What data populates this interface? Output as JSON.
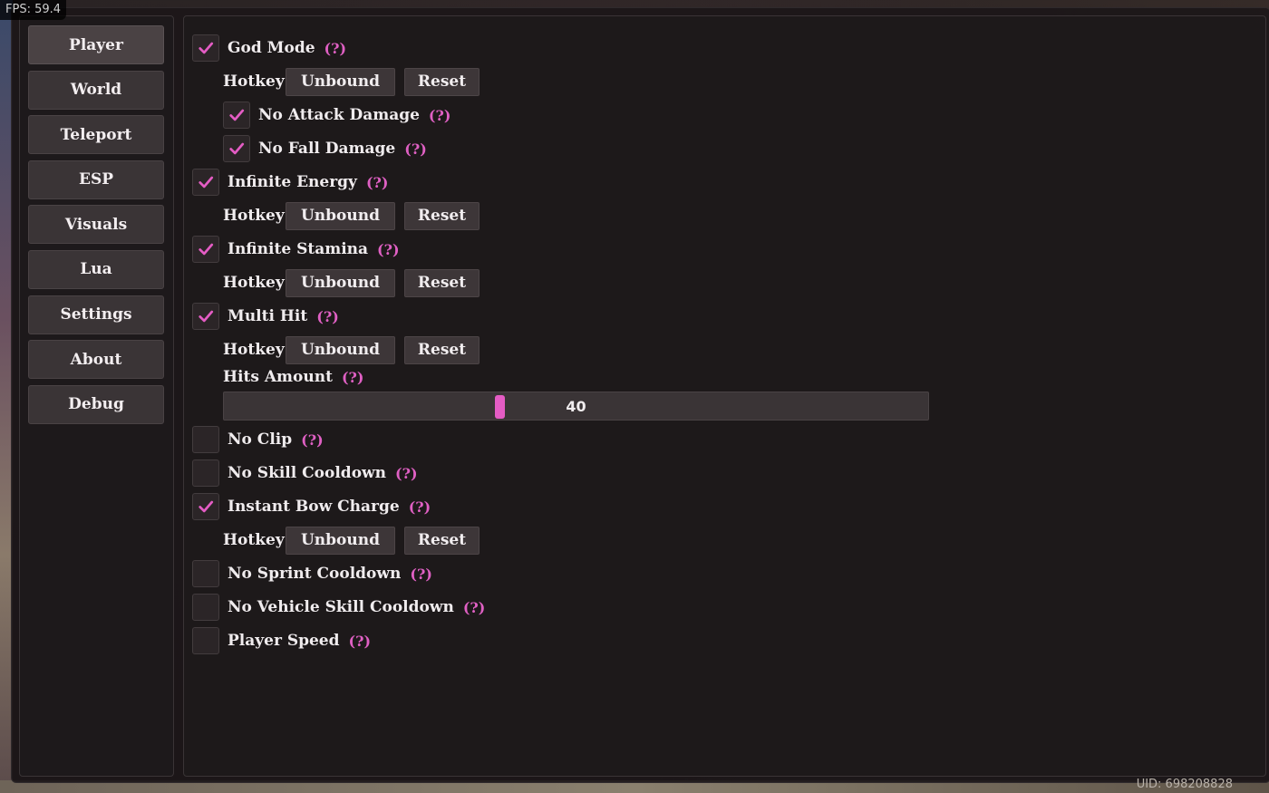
{
  "overlay": {
    "fps_text": "FPS: 59.4",
    "uid_text": "UID: 698208828"
  },
  "colors": {
    "accent": "#e45cc4",
    "help": "#e060c4",
    "panel": "#1e191b",
    "button": "#3d3638"
  },
  "sidebar": {
    "items": [
      {
        "label": "Player",
        "active": true
      },
      {
        "label": "World"
      },
      {
        "label": "Teleport"
      },
      {
        "label": "ESP"
      },
      {
        "label": "Visuals"
      },
      {
        "label": "Lua"
      },
      {
        "label": "Settings"
      },
      {
        "label": "About"
      },
      {
        "label": "Debug"
      }
    ]
  },
  "player": {
    "help": "(?)",
    "hotkey_label": "Hotkey",
    "unbound_label": "Unbound",
    "reset_label": "Reset",
    "god_mode": {
      "label": "God Mode",
      "checked": true
    },
    "no_attack_damage": {
      "label": "No Attack Damage",
      "checked": true
    },
    "no_fall_damage": {
      "label": "No Fall Damage",
      "checked": true
    },
    "infinite_energy": {
      "label": "Infinite Energy",
      "checked": true
    },
    "infinite_stamina": {
      "label": "Infinite Stamina",
      "checked": true
    },
    "multi_hit": {
      "label": "Multi Hit",
      "checked": true
    },
    "hits_amount": {
      "label": "Hits Amount",
      "value": "40",
      "fraction": 0.39
    },
    "no_clip": {
      "label": "No Clip",
      "checked": false
    },
    "no_skill_cooldown": {
      "label": "No Skill Cooldown",
      "checked": false
    },
    "instant_bow_charge": {
      "label": "Instant Bow Charge",
      "checked": true
    },
    "no_sprint_cooldown": {
      "label": "No Sprint Cooldown",
      "checked": false
    },
    "no_vehicle_skill_cooldown": {
      "label": "No Vehicle Skill Cooldown",
      "checked": false
    },
    "player_speed": {
      "label": "Player Speed",
      "checked": false
    }
  }
}
